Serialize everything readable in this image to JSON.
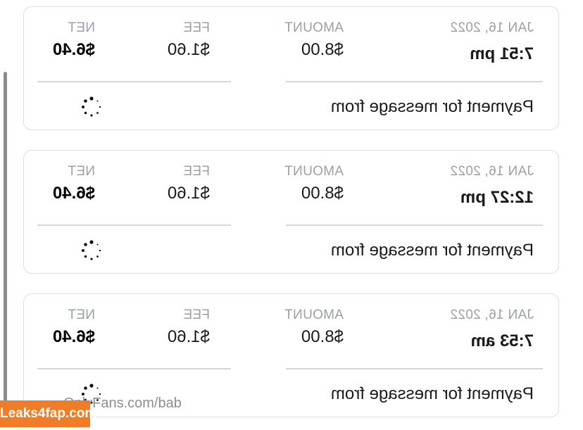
{
  "transactions": [
    {
      "date": "JAN 16, 2022",
      "time": "7:51 pm",
      "amount_label": "AMOUNT",
      "amount": "$8.00",
      "fee_label": "FEE",
      "fee": "$1.60",
      "net_label": "NET",
      "net": "$6.40",
      "description": "Payment for message from"
    },
    {
      "date": "JAN 16, 2022",
      "time": "12:27 pm",
      "amount_label": "AMOUNT",
      "amount": "$8.00",
      "fee_label": "FEE",
      "fee": "$1.60",
      "net_label": "NET",
      "net": "$6.40",
      "description": "Payment for message from"
    },
    {
      "date": "JAN 16, 2022",
      "time": "7:53 am",
      "amount_label": "AMOUNT",
      "amount": "$8.00",
      "fee_label": "FEE",
      "fee": "$1.60",
      "net_label": "NET",
      "net": "$6.40",
      "description": "Payment for message from"
    }
  ],
  "watermark": {
    "url": "OnlyFans.com/bab",
    "logo": "Leaks4fap.com"
  },
  "icons": {
    "status": "loading-spinner-icon"
  }
}
